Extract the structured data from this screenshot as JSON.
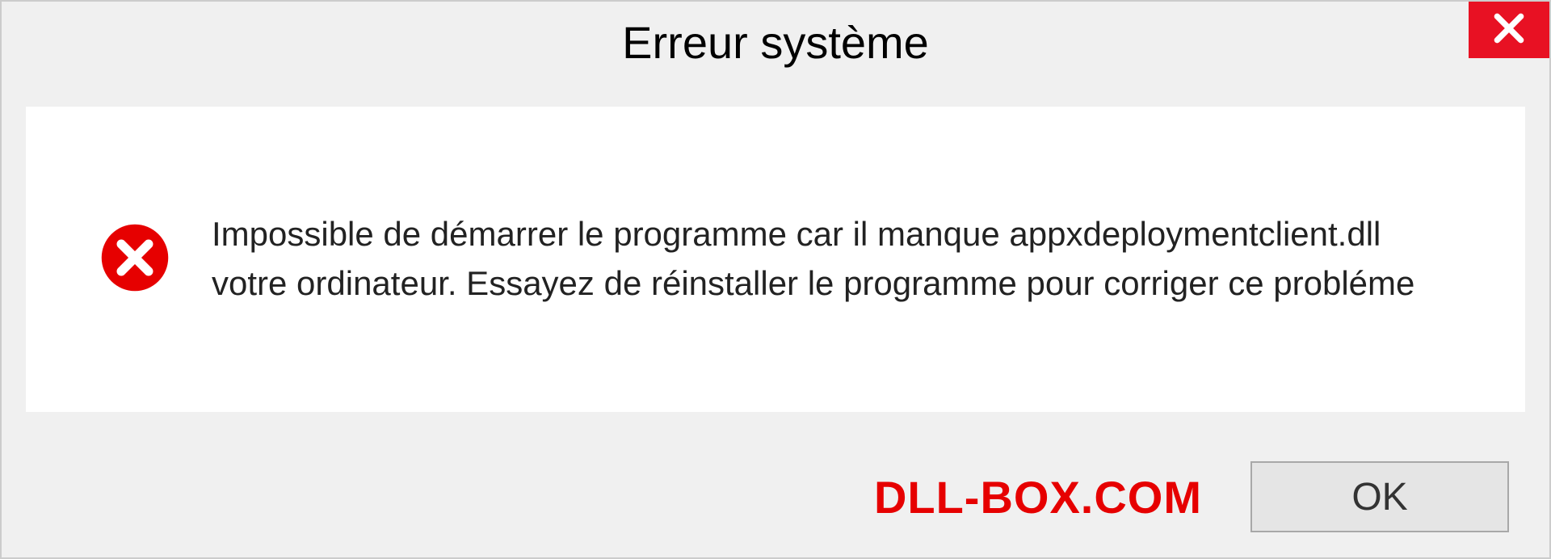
{
  "titlebar": {
    "title": "Erreur système"
  },
  "message": {
    "text": "Impossible de démarrer le programme car il manque appxdeploymentclient.dll votre ordinateur. Essayez de réinstaller le programme pour corriger ce probléme"
  },
  "footer": {
    "brand": "DLL-BOX.COM",
    "ok_label": "OK"
  },
  "colors": {
    "close_bg": "#e81123",
    "error_red": "#e60000",
    "brand_red": "#e60000"
  }
}
